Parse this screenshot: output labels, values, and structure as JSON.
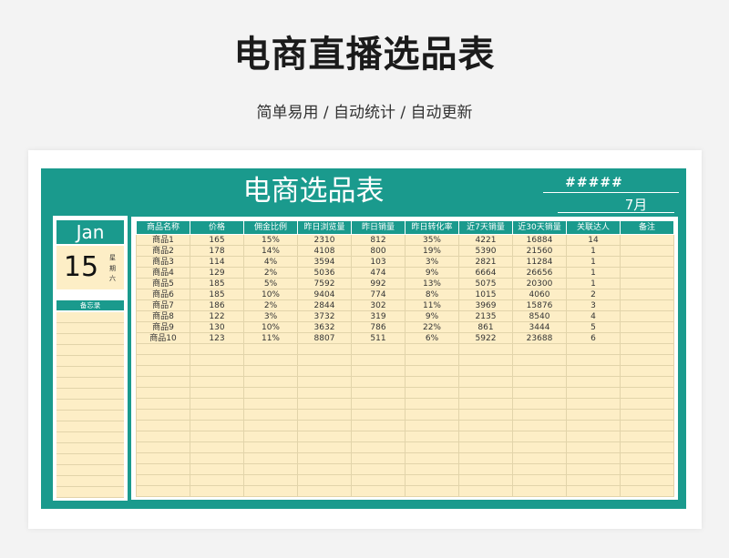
{
  "page": {
    "title": "电商直播选品表",
    "subtitle": "简单易用 / 自动统计 / 自动更新"
  },
  "sheet": {
    "title": "电商选品表",
    "hash_cell": "#####",
    "month": "7月",
    "date": {
      "month": "Jan",
      "day": "15",
      "weekday": "星期六"
    },
    "memo_label": "备忘录",
    "columns": [
      "商品名称",
      "价格",
      "佣金比例",
      "昨日浏览量",
      "昨日销量",
      "昨日转化率",
      "近7天销量",
      "近30天销量",
      "关联达人",
      "备注"
    ],
    "rows": [
      [
        "商品1",
        "165",
        "15%",
        "2310",
        "812",
        "35%",
        "4221",
        "16884",
        "14",
        ""
      ],
      [
        "商品2",
        "178",
        "14%",
        "4108",
        "800",
        "19%",
        "5390",
        "21560",
        "1",
        ""
      ],
      [
        "商品3",
        "114",
        "4%",
        "3594",
        "103",
        "3%",
        "2821",
        "11284",
        "1",
        ""
      ],
      [
        "商品4",
        "129",
        "2%",
        "5036",
        "474",
        "9%",
        "6664",
        "26656",
        "1",
        ""
      ],
      [
        "商品5",
        "185",
        "5%",
        "7592",
        "992",
        "13%",
        "5075",
        "20300",
        "1",
        ""
      ],
      [
        "商品6",
        "185",
        "10%",
        "9404",
        "774",
        "8%",
        "1015",
        "4060",
        "2",
        ""
      ],
      [
        "商品7",
        "186",
        "2%",
        "2844",
        "302",
        "11%",
        "3969",
        "15876",
        "3",
        ""
      ],
      [
        "商品8",
        "122",
        "3%",
        "3732",
        "319",
        "9%",
        "2135",
        "8540",
        "4",
        ""
      ],
      [
        "商品9",
        "130",
        "10%",
        "3632",
        "786",
        "22%",
        "861",
        "3444",
        "5",
        ""
      ],
      [
        "商品10",
        "123",
        "11%",
        "8807",
        "511",
        "6%",
        "5922",
        "23688",
        "6",
        ""
      ]
    ]
  },
  "colors": {
    "accent": "#1a9a8d",
    "cream": "#fdeec6",
    "grid": "#e2d4aa"
  }
}
